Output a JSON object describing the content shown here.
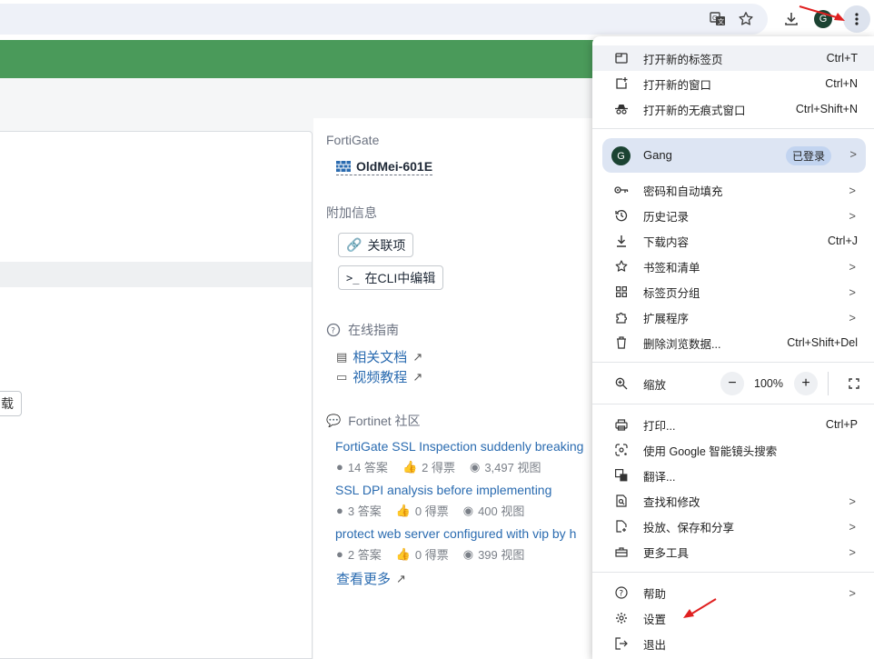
{
  "toolbar": {
    "translate_icon": "translate-icon",
    "bookmark_icon": "star-icon",
    "download_icon": "download-icon",
    "profile_initial": "G",
    "menu_icon": "kebab-menu-icon"
  },
  "page": {
    "partial_button": "载",
    "fortigate_label": "FortiGate",
    "device_name": "OldMei-601E",
    "extra_info_label": "附加信息",
    "related_btn": "关联项",
    "cli_btn": "在CLI中编辑",
    "guide_label": "在线指南",
    "docs_link": "相关文档",
    "video_link": "视频教程",
    "community_label": "Fortinet 社区",
    "posts": [
      {
        "title": "FortiGate SSL Inspection suddenly breaking",
        "answers": "14 答案",
        "votes": "2 得票",
        "views": "3,497 视图"
      },
      {
        "title": "SSL DPI analysis before implementing",
        "answers": "3 答案",
        "votes": "0 得票",
        "views": "400 视图"
      },
      {
        "title": "protect web server configured with vip by h",
        "answers": "2 答案",
        "votes": "0 得票",
        "views": "399 视图"
      }
    ],
    "more_link": "查看更多"
  },
  "menu": {
    "new_tab": "打开新的标签页",
    "new_tab_sc": "Ctrl+T",
    "new_window": "打开新的窗口",
    "new_window_sc": "Ctrl+N",
    "incognito": "打开新的无痕式窗口",
    "incognito_sc": "Ctrl+Shift+N",
    "profile_initial": "G",
    "profile_name": "Gang",
    "profile_status": "已登录",
    "passwords": "密码和自动填充",
    "history": "历史记录",
    "downloads": "下载内容",
    "downloads_sc": "Ctrl+J",
    "bookmarks": "书签和清单",
    "tab_groups": "标签页分组",
    "extensions": "扩展程序",
    "clear_data": "删除浏览数据...",
    "clear_data_sc": "Ctrl+Shift+Del",
    "zoom_label": "缩放",
    "zoom_minus": "−",
    "zoom_value": "100%",
    "zoom_plus": "+",
    "print": "打印...",
    "print_sc": "Ctrl+P",
    "lens": "使用 Google 智能镜头搜索",
    "translate": "翻译...",
    "find_edit": "查找和修改",
    "cast_save": "投放、保存和分享",
    "more_tools": "更多工具",
    "help": "帮助",
    "settings": "设置",
    "exit": "退出"
  },
  "colors": {
    "accent_green": "#4a9a5a",
    "link_blue": "#2a6bb0",
    "profile_dark": "#1b4332",
    "annotation_red": "#e02020"
  }
}
